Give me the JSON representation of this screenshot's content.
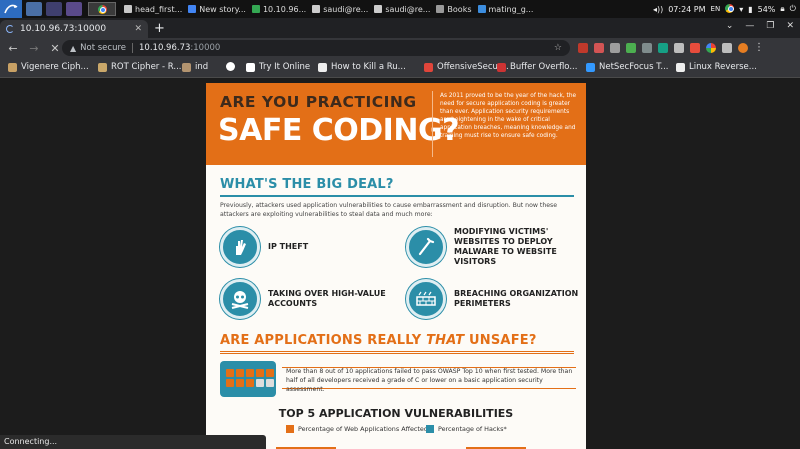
{
  "taskbar": {
    "tasks": [
      {
        "label": "head_first...",
        "color": "#c8c8c8"
      },
      {
        "label": "New story...",
        "color": "#4285f4"
      },
      {
        "label": "10.10.96...",
        "color": "#34a853"
      },
      {
        "label": "saudi@re...",
        "color": "#cccccc"
      },
      {
        "label": "saudi@re...",
        "color": "#cccccc"
      },
      {
        "label": "Books",
        "color": "#999999"
      },
      {
        "label": "mating_g...",
        "color": "#3c8dde"
      }
    ],
    "clock": "07:24 PM",
    "keyboard": "EN",
    "battery": "54%"
  },
  "browser": {
    "tab_title": "10.10.96.73:10000",
    "new_tab": "+",
    "security_label": "Not secure",
    "url_host": "10.10.96.73",
    "url_port": ":10000",
    "bookmarks": [
      "Vigenere Ciph...",
      "ROT Cipher - R...",
      "ind",
      "",
      "Try It Online",
      "How to Kill a Ru...",
      "OffensiveSecur...",
      "Buffer Overflo...",
      "NetSecFocus T...",
      "Linux Reverse..."
    ],
    "status_text": "Connecting..."
  },
  "infographic": {
    "hero_line1": "ARE YOU PRACTICING",
    "hero_line2": "SAFE CODING?",
    "hero_text": "As 2011 proved to be the year of the hack, the need for secure application coding is greater than ever. Application security requirements are heightening in the wake of critical application breaches, meaning knowledge and training must rise to ensure safe coding.",
    "section1_title": "WHAT'S THE BIG DEAL?",
    "section1_intro": "Previously, attackers used application vulnerabilities to cause embarrassment and disruption. But now these attackers are exploiting vulnerabilities to steal data and much more:",
    "threats": [
      {
        "label": "IP THEFT",
        "icon": "hand-icon"
      },
      {
        "label": "MODIFYING VICTIMS' WEBSITES TO DEPLOY MALWARE TO WEBSITE VISITORS",
        "icon": "crowbar-icon"
      },
      {
        "label": "TAKING OVER HIGH-VALUE ACCOUNTS",
        "icon": "skull-crossbones-icon"
      },
      {
        "label": "BREACHING ORGANIZATION PERIMETERS",
        "icon": "firewall-icon"
      }
    ],
    "section2_pre": "ARE APPLICATIONS REALLY ",
    "section2_mid": "THAT",
    "section2_post": " UNSAFE?",
    "stat_text": "More than 8 out of 10 applications failed to pass OWASP Top 10 when first tested. More than half of all developers received a grade of C or lower on a basic application security assessment.",
    "chart_title": "TOP 5 APPLICATION VULNERABILITIES",
    "legend_a": "Percentage of Web Applications Affected",
    "legend_b": "Percentage of Hacks*",
    "colors": {
      "orange": "#e36f17",
      "teal": "#2b8ea8"
    }
  }
}
